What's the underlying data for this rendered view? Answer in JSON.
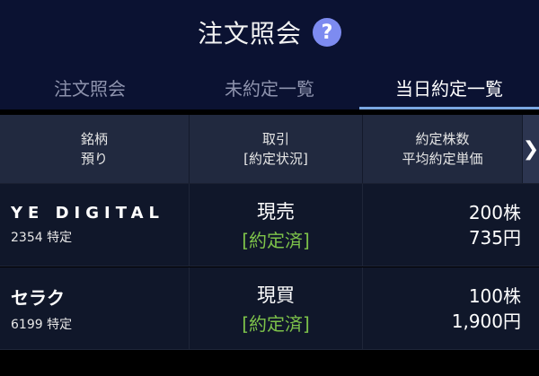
{
  "header": {
    "title": "注文照会",
    "help_label": "?"
  },
  "tabs": [
    {
      "label": "注文照会",
      "active": false
    },
    {
      "label": "未約定一覧",
      "active": false
    },
    {
      "label": "当日約定一覧",
      "active": true
    }
  ],
  "table": {
    "headers": [
      {
        "line1": "銘柄",
        "line2": "預り"
      },
      {
        "line1": "取引",
        "line2": "[約定状況]"
      },
      {
        "line1": "約定株数",
        "line2": "平均約定単価"
      }
    ],
    "next_label": "❯",
    "rows": [
      {
        "name": "YE DIGITAL",
        "code": "2354 特定",
        "trade_type": "現売",
        "status": "[約定済]",
        "quantity": "200株",
        "price": "735円"
      },
      {
        "name": "セラク",
        "code": "6199 特定",
        "trade_type": "現買",
        "status": "[約定済]",
        "quantity": "100株",
        "price": "1,900円"
      }
    ]
  },
  "colors": {
    "accent": "#7aa7e2",
    "status_green": "#7dc24a",
    "help_badge": "#7d8bf0"
  }
}
